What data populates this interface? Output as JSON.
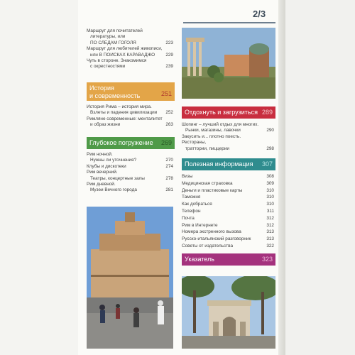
{
  "page_number": "2/3",
  "sections": {
    "top_list": [
      {
        "lines": [
          "Маршрут для почитателей",
          "литературы, или",
          "ПО СЛЕДАМ ГОГОЛЯ"
        ],
        "page": "223"
      },
      {
        "lines": [
          "Маршрут для любителей живописи,",
          "или В ПОИСКАХ КАРАВАДЖО"
        ],
        "page": "229"
      },
      {
        "lines": [
          "Чуть в стороне. Знакомимся",
          "с окрестностями"
        ],
        "page": "239"
      }
    ],
    "history": {
      "title_line1": "История",
      "title_line2": "и современность",
      "page": "251",
      "entries": [
        {
          "lines": [
            "История Рима – история мира.",
            "Взлеты и падения цивилизации"
          ],
          "page": "252"
        },
        {
          "lines": [
            "Римляне современные: менталитет",
            "и образ жизни"
          ],
          "page": "263"
        }
      ]
    },
    "deep": {
      "title": "Глубокое погружение",
      "page": "269",
      "entries": [
        {
          "lines": [
            "Рим ночной.",
            "Нужны ли уточнения?"
          ],
          "page": "270"
        },
        {
          "lines": [
            "Клубы и дискотеки"
          ],
          "page": "274"
        },
        {
          "lines": [
            "Рим вечерний.",
            "Театры, концертные залы"
          ],
          "page": "278"
        },
        {
          "lines": [
            "Рим дневной.",
            "Музеи Вечного города"
          ],
          "page": "281"
        }
      ]
    },
    "rest": {
      "title": "Отдохнуть и загрузиться",
      "page": "289",
      "entries": [
        {
          "lines": [
            "Шопинг – лучший отдых для многих.",
            "Рынки, магазины, лавочки"
          ],
          "page": "290"
        },
        {
          "lines": [
            "Закусить и... плотно поесть. Рестораны,",
            "траттории, пиццерии"
          ],
          "page": "298"
        }
      ]
    },
    "useful": {
      "title": "Полезная информация",
      "page": "307",
      "entries": [
        {
          "label": "Визы",
          "page": "308"
        },
        {
          "label": "Медицинская страховка",
          "page": "309"
        },
        {
          "label": "Деньги и пластиковые карты",
          "page": "310"
        },
        {
          "label": "Таможня",
          "page": "310"
        },
        {
          "label": "Как добраться",
          "page": "310"
        },
        {
          "label": "Телефон",
          "page": "311"
        },
        {
          "label": "Почта",
          "page": "312"
        },
        {
          "label": "Рим в Интернете",
          "page": "312"
        },
        {
          "label": "Номера экстренного вызова",
          "page": "313"
        },
        {
          "label": "Русско-итальянский разговорник",
          "page": "313"
        },
        {
          "label": "Советы от издательства",
          "page": "322"
        }
      ]
    },
    "index": {
      "title": "Указатель",
      "page": "323"
    }
  },
  "colors": {
    "history": "#e3a548",
    "deep": "#4f9a48",
    "rest": "#c82e3f",
    "useful": "#2f8c8e",
    "index": "#a4327d"
  },
  "images": [
    "forum-ruins-photo",
    "castel-sant-angelo-photo",
    "arch-of-constantine-photo"
  ]
}
